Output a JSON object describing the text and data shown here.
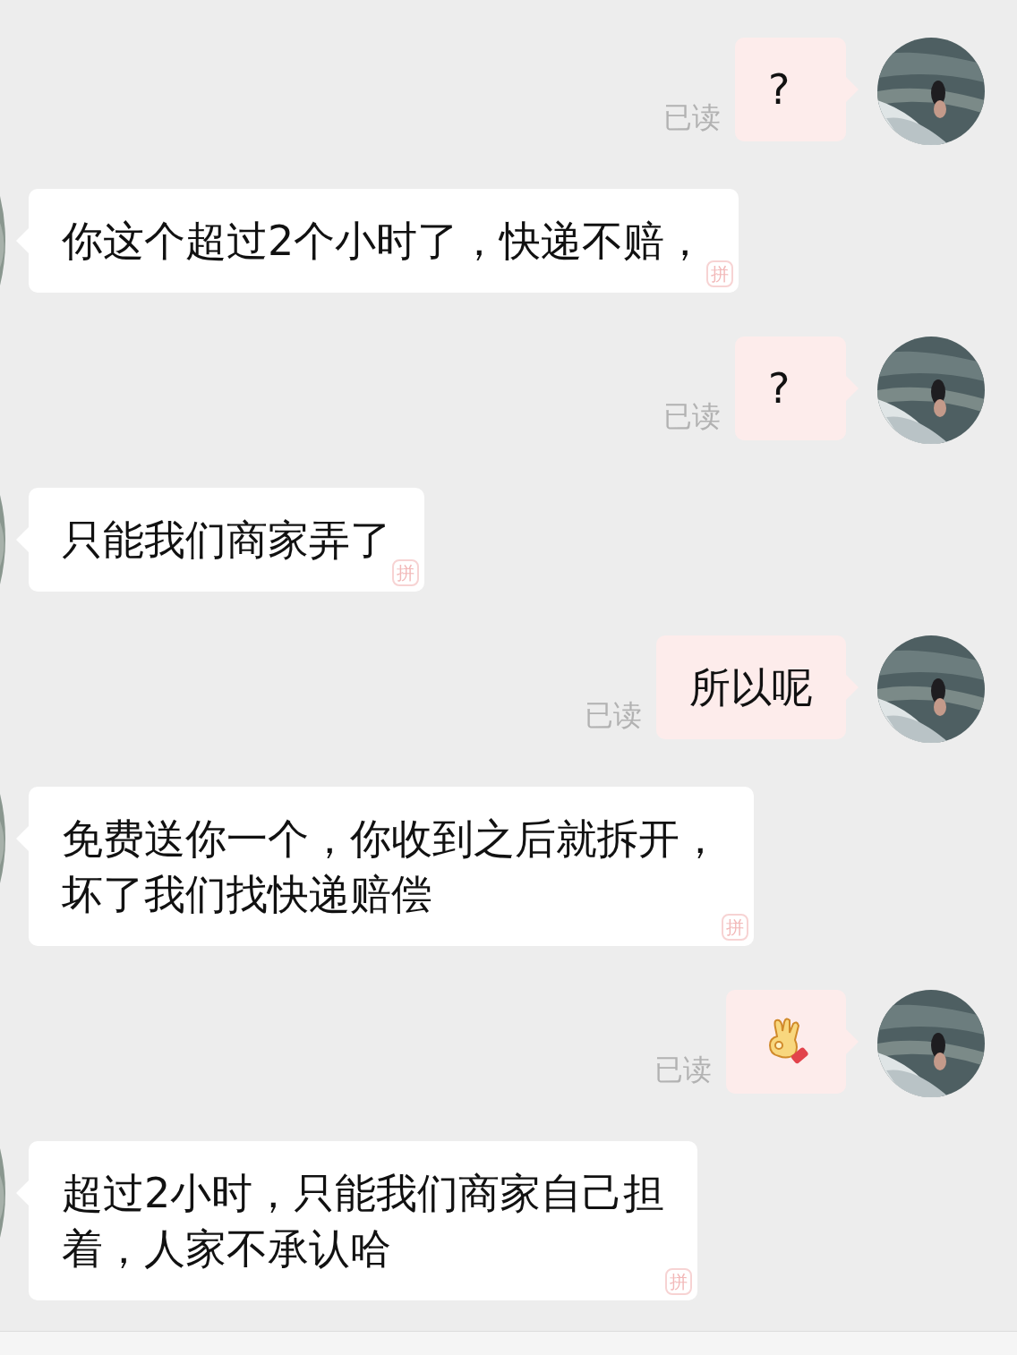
{
  "messages": [
    {
      "kind": "sent_text",
      "lines": [
        "?"
      ],
      "read": "已读"
    },
    {
      "kind": "received_text",
      "lines": [
        "你这个超过2个小时了，快递不赔，"
      ],
      "badge": "拼"
    },
    {
      "kind": "sent_text",
      "lines": [
        "?"
      ],
      "read": "已读"
    },
    {
      "kind": "received_text",
      "lines": [
        "只能我们商家弄了"
      ],
      "badge": "拼"
    },
    {
      "kind": "sent_text",
      "lines": [
        "所以呢"
      ],
      "read": "已读"
    },
    {
      "kind": "received_text",
      "lines": [
        "免费送你一个，你收到之后就拆开，",
        "坏了我们找快递赔偿"
      ],
      "badge": "拼"
    },
    {
      "kind": "sent_emoji",
      "read": "已读"
    },
    {
      "kind": "received_text",
      "lines": [
        "超过2小时，只能我们商家自己担",
        "着，人家不承认哈"
      ],
      "badge": "拼"
    }
  ]
}
